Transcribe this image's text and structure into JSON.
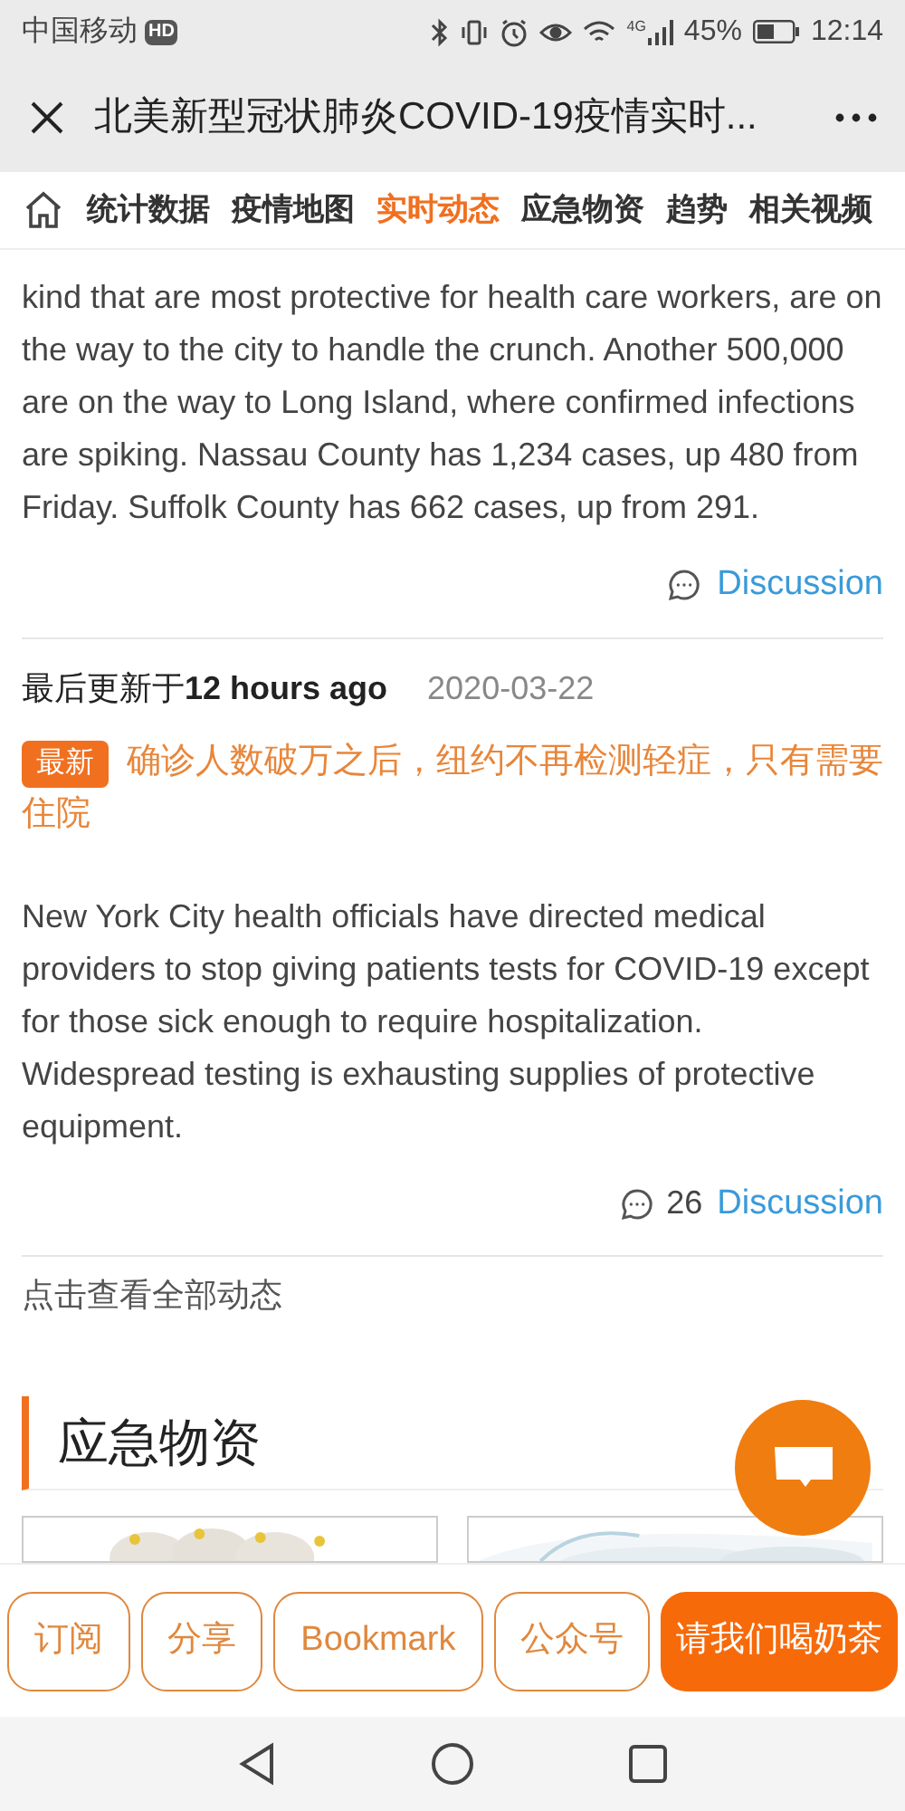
{
  "status_bar": {
    "carrier": "中国移动",
    "hd_badge": "HD",
    "network": "4G",
    "battery": "45%",
    "time": "12:14"
  },
  "title_bar": {
    "title": "北美新型冠状肺炎COVID-19疫情实时..."
  },
  "tabs": [
    {
      "label": "统计数据",
      "selected": false
    },
    {
      "label": "疫情地图",
      "selected": false
    },
    {
      "label": "实时动态",
      "selected": true
    },
    {
      "label": "应急物资",
      "selected": false
    },
    {
      "label": "趋势",
      "selected": false
    },
    {
      "label": "相关视频",
      "selected": false
    }
  ],
  "posts": [
    {
      "body": "kind that are most protective for health care workers, are on the way to the city to handle the crunch. Another 500,000 are on the way to Long Island, where confirmed infections are spiking. Nassau County has 1,234 cases, up 480 from Friday. Suffolk County has 662 cases, up from 291.",
      "discussion": "Discussion"
    },
    {
      "updated": "最后更新于**12 hours ago**",
      "date": "2020-03-22",
      "badge": "最新",
      "headline": "确诊人数破万之后，纽约不再检测轻症，只有需要住院",
      "body": "New York City health officials have directed medical providers to stop giving patients tests for COVID-19 except for those sick enough to require hospitalization. Widespread testing is exhausting supplies of protective equipment.",
      "comment_count": "26",
      "discussion": "Discussion"
    }
  ],
  "view_all": "点击查看全部动态",
  "section": {
    "title": "应急物资"
  },
  "bottom_buttons": [
    {
      "label": "订阅",
      "kind": "outline"
    },
    {
      "label": "分享",
      "kind": "outline"
    },
    {
      "label": "Bookmark",
      "kind": "outline"
    },
    {
      "label": "公众号",
      "kind": "outline"
    },
    {
      "label": "请我们喝奶茶",
      "kind": "filled"
    }
  ]
}
